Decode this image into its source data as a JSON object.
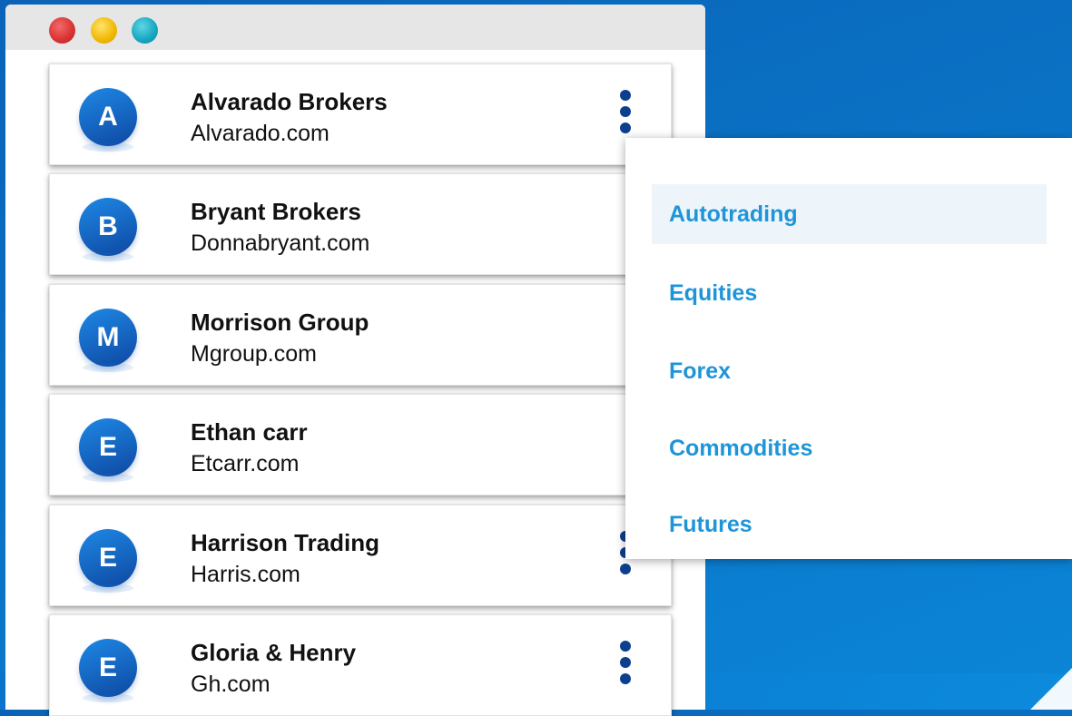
{
  "window": {
    "buttons": [
      {
        "name": "close",
        "color": "#d83131"
      },
      {
        "name": "minimize",
        "color": "#f0b700"
      },
      {
        "name": "maximize",
        "color": "#16a5bf"
      }
    ]
  },
  "contacts": [
    {
      "initial": "A",
      "name": "Alvarado Brokers",
      "domain": "Alvarado.com",
      "menu_icon": "kebab-icon"
    },
    {
      "initial": "B",
      "name": "Bryant Brokers",
      "domain": "Donnabryant.com",
      "menu_icon": "kebab-icon"
    },
    {
      "initial": "M",
      "name": "Morrison Group",
      "domain": "Mgroup.com",
      "menu_icon": "kebab-icon"
    },
    {
      "initial": "E",
      "name": "Ethan carr",
      "domain": "Etcarr.com",
      "menu_icon": "kebab-icon"
    },
    {
      "initial": "E",
      "name": "Harrison Trading",
      "domain": "Harris.com",
      "menu_icon": "kebab-icon"
    },
    {
      "initial": "E",
      "name": "Gloria & Henry",
      "domain": "Gh.com",
      "menu_icon": "kebab-icon"
    }
  ],
  "context_menu": {
    "items": [
      {
        "label": "Autotrading",
        "active": true
      },
      {
        "label": "Equities",
        "active": false
      },
      {
        "label": "Forex",
        "active": false
      },
      {
        "label": "Commodities",
        "active": false
      },
      {
        "label": "Futures",
        "active": false
      }
    ]
  },
  "colors": {
    "accent_text": "#1e95d8",
    "avatar": "#1565c0",
    "kebab": "#0d3f8f",
    "background": "#0a72c4"
  }
}
